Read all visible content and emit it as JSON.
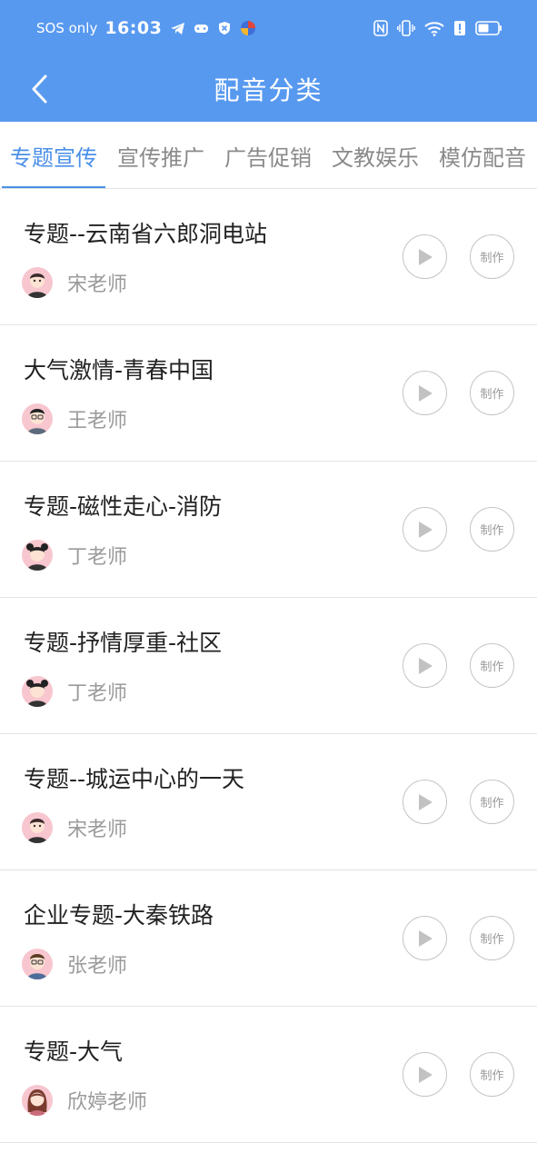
{
  "status_bar": {
    "carrier": "SOS only",
    "time": "16:03",
    "icons_left": [
      "telegram-icon",
      "game-controller-icon",
      "shield-icon",
      "app-icon"
    ],
    "icons_right": [
      "nfc-icon",
      "vibrate-icon",
      "wifi-icon",
      "alert-icon",
      "battery-icon"
    ]
  },
  "header": {
    "title": "配音分类",
    "back_icon": "chevron-left-icon"
  },
  "tabs": [
    {
      "label": "专题宣传",
      "active": true
    },
    {
      "label": "宣传推广",
      "active": false
    },
    {
      "label": "广告促销",
      "active": false
    },
    {
      "label": "文教娱乐",
      "active": false
    },
    {
      "label": "模仿配音",
      "active": false
    }
  ],
  "items": [
    {
      "title": "专题--云南省六郎洞电站",
      "author": "宋老师",
      "make_label": "制作"
    },
    {
      "title": "大气激情-青春中国",
      "author": "王老师",
      "make_label": "制作"
    },
    {
      "title": "专题-磁性走心-消防",
      "author": "丁老师",
      "make_label": "制作"
    },
    {
      "title": "专题-抒情厚重-社区",
      "author": "丁老师",
      "make_label": "制作"
    },
    {
      "title": "专题--城运中心的一天",
      "author": "宋老师",
      "make_label": "制作"
    },
    {
      "title": "企业专题-大秦铁路",
      "author": "张老师",
      "make_label": "制作"
    },
    {
      "title": "专题-大气",
      "author": "欣婷老师",
      "make_label": "制作"
    }
  ],
  "colors": {
    "primary": "#5899f0",
    "tab_active": "#4a8fe8",
    "avatar_bg": "#f7c6cf"
  }
}
